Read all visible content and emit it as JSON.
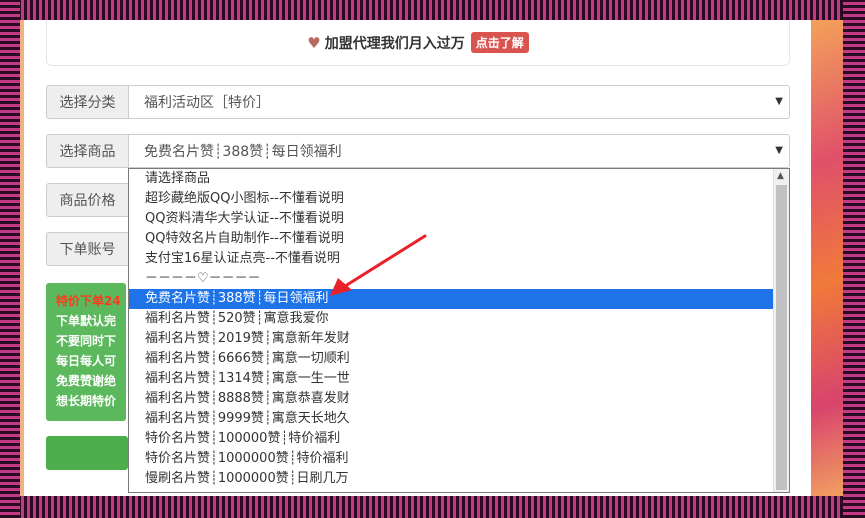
{
  "notice": {
    "text": "加盟代理我们月入过万",
    "button": "点击了解"
  },
  "category": {
    "label": "选择分类",
    "value": "福利活动区［特价］"
  },
  "product": {
    "label": "选择商品",
    "value": "免费名片赞┊388赞┊每日领福利"
  },
  "price": {
    "label": "商品价格"
  },
  "account": {
    "label": "下单账号"
  },
  "info_box": {
    "lines": [
      "特价下单24",
      "下单默认完",
      "不要同时下",
      "每日每人可",
      "免费赞谢绝",
      "想长期特价"
    ]
  },
  "dropdown": {
    "options": [
      "请选择商品",
      "超珍藏绝版QQ小图标--不懂看说明",
      "QQ资料清华大学认证--不懂看说明",
      "QQ特效名片自助制作--不懂看说明",
      "支付宝16星认证点亮--不懂看说明",
      "－－－－♡－－－－",
      "免费名片赞┊388赞┊每日领福利",
      "福利名片赞┊520赞┊寓意我爱你",
      "福利名片赞┊2019赞┊寓意新年发财",
      "福利名片赞┊6666赞┊寓意一切顺利",
      "福利名片赞┊1314赞┊寓意一生一世",
      "福利名片赞┊8888赞┊寓意恭喜发财",
      "福利名片赞┊9999赞┊寓意天长地久",
      "特价名片赞┊100000赞┊特价福利",
      "特价名片赞┊1000000赞┊特价福利",
      "慢刷名片赞┊1000000赞┊日刷几万"
    ],
    "selected_index": 6
  },
  "colors": {
    "selected": "#1e73e8",
    "arrow": "#e8212b",
    "green": "#5cb85c"
  }
}
